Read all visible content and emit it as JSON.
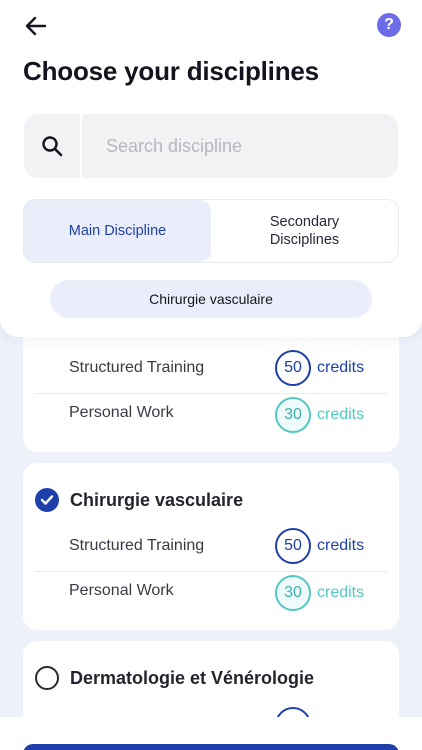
{
  "header": {
    "title": "Choose your disciplines",
    "help_symbol": "?",
    "back_icon": "arrow-left-icon",
    "help_icon": "question-circle-icon"
  },
  "search": {
    "placeholder": "Search discipline",
    "value": "",
    "icon": "search-icon"
  },
  "tabs": [
    {
      "label": "Main Discipline",
      "active": true
    },
    {
      "label": "Secondary\nDisciplines",
      "active": false
    }
  ],
  "selected_chip": "Chirurgie vasculaire",
  "cards": [
    {
      "rows": [
        {
          "label": "Structured Training",
          "credits": "50",
          "unit": "credits"
        },
        {
          "label": "Personal Work",
          "credits": "30",
          "unit": "credits"
        }
      ]
    },
    {
      "title": "Chirurgie vasculaire",
      "checked": true,
      "rows": [
        {
          "label": "Structured Training",
          "credits": "50",
          "unit": "credits"
        },
        {
          "label": "Personal Work",
          "credits": "30",
          "unit": "credits"
        }
      ]
    },
    {
      "title": "Dermatologie et Vénérologie",
      "checked": false
    }
  ],
  "colors": {
    "primary": "#1f3fa8",
    "teal": "#52c8c2",
    "help": "#6c6be8",
    "background": "#eef0fa"
  }
}
